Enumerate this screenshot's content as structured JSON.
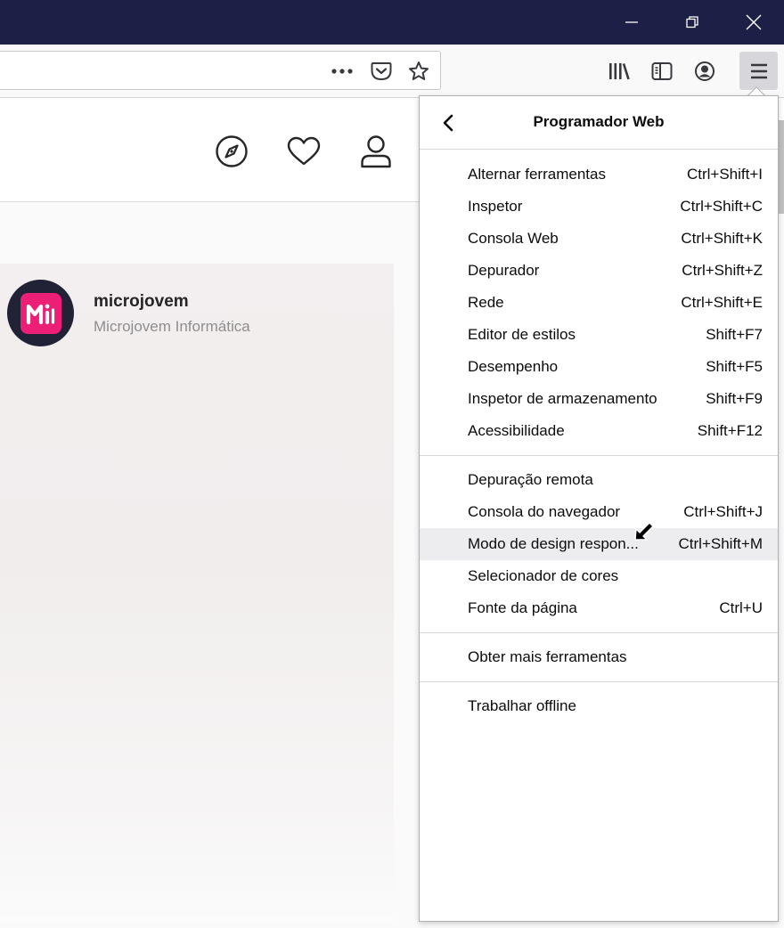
{
  "window": {
    "controls": [
      "minimize-icon",
      "restore-icon",
      "close-icon"
    ]
  },
  "toolbar": {
    "url_icons": [
      "more-dots-icon",
      "pocket-icon",
      "bookmark-star-icon"
    ],
    "icons": [
      "library-icon",
      "sidebar-icon",
      "account-icon",
      "hamburger-menu-icon"
    ]
  },
  "page": {
    "header_icons": [
      "explore-compass-icon",
      "activity-heart-icon",
      "profile-icon"
    ],
    "profile": {
      "username": "microjovem",
      "full_name": "Microjovem Informática"
    }
  },
  "menu": {
    "title": "Programador Web",
    "group1": [
      {
        "label": "Alternar ferramentas",
        "shortcut": "Ctrl+Shift+I"
      },
      {
        "label": "Inspetor",
        "shortcut": "Ctrl+Shift+C"
      },
      {
        "label": "Consola Web",
        "shortcut": "Ctrl+Shift+K"
      },
      {
        "label": "Depurador",
        "shortcut": "Ctrl+Shift+Z"
      },
      {
        "label": "Rede",
        "shortcut": "Ctrl+Shift+E"
      },
      {
        "label": "Editor de estilos",
        "shortcut": "Shift+F7"
      },
      {
        "label": "Desempenho",
        "shortcut": "Shift+F5"
      },
      {
        "label": "Inspetor de armazenamento",
        "shortcut": "Shift+F9"
      },
      {
        "label": "Acessibilidade",
        "shortcut": "Shift+F12"
      }
    ],
    "group2": [
      {
        "label": "Depuração remota",
        "shortcut": ""
      },
      {
        "label": "Consola do navegador",
        "shortcut": "Ctrl+Shift+J"
      },
      {
        "label": "Modo de design respon...",
        "shortcut": "Ctrl+Shift+M"
      },
      {
        "label": "Selecionador de cores",
        "shortcut": ""
      },
      {
        "label": "Fonte da página",
        "shortcut": "Ctrl+U"
      }
    ],
    "group3": [
      {
        "label": "Obter mais ferramentas",
        "shortcut": ""
      }
    ],
    "group4": [
      {
        "label": "Trabalhar offline",
        "shortcut": ""
      }
    ],
    "highlighted": "Modo de design respon..."
  },
  "colors": {
    "titlebar": "#1d1f47",
    "highlight": "#ededf0",
    "brand_pink": "#ec1e76"
  }
}
